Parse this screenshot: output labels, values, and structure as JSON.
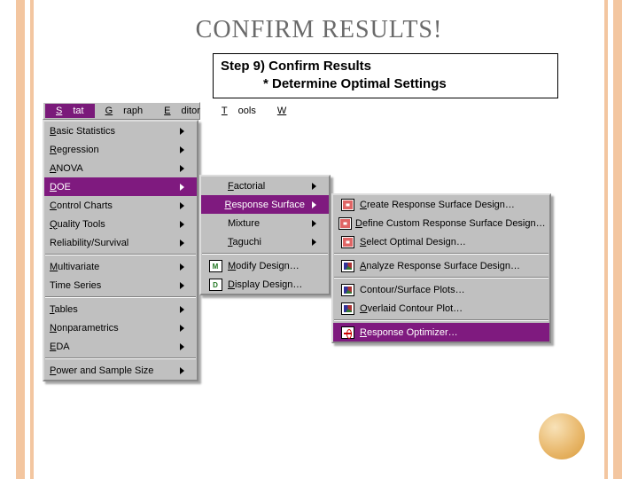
{
  "title": "CONFIRM RESULTS!",
  "step": {
    "line1": "Step 9) Confirm Results",
    "line2": "* Determine Optimal Settings"
  },
  "menubar": {
    "items": [
      {
        "label": "Stat",
        "mnemo": "S",
        "rest": "tat",
        "selected": true
      },
      {
        "label": "Graph",
        "mnemo": "G",
        "rest": "raph"
      },
      {
        "label": "Editor",
        "mnemo": "E",
        "rest": "ditor"
      },
      {
        "label": "Tools",
        "mnemo": "T",
        "rest": "ools"
      },
      {
        "label": "W",
        "mnemo": "W",
        "rest": ""
      }
    ]
  },
  "statMenu": {
    "items": [
      {
        "label": "Basic Statistics",
        "mnemo": "B",
        "rest": "asic Statistics",
        "sub": true
      },
      {
        "label": "Regression",
        "mnemo": "R",
        "rest": "egression",
        "sub": true
      },
      {
        "label": "ANOVA",
        "mnemo": "A",
        "rest": "NOVA",
        "sub": true
      },
      {
        "label": "DOE",
        "mnemo": "D",
        "rest": "OE",
        "sub": true,
        "hl": true
      },
      {
        "label": "Control Charts",
        "mnemo": "C",
        "rest": "ontrol Charts",
        "sub": true
      },
      {
        "label": "Quality Tools",
        "mnemo": "Q",
        "rest": "uality Tools",
        "sub": true
      },
      {
        "label": "Reliability/Survival",
        "mnemo": "",
        "rest": "Reliability/Survival",
        "sub": true
      },
      {
        "sep": true
      },
      {
        "label": "Multivariate",
        "mnemo": "M",
        "rest": "ultivariate",
        "sub": true
      },
      {
        "label": "Time Series",
        "mnemo": "",
        "rest": "Time Series",
        "sub": true
      },
      {
        "sep": true
      },
      {
        "label": "Tables",
        "mnemo": "T",
        "rest": "ables",
        "sub": true
      },
      {
        "label": "Nonparametrics",
        "mnemo": "N",
        "rest": "onparametrics",
        "sub": true
      },
      {
        "label": "EDA",
        "mnemo": "E",
        "rest": "DA",
        "sub": true
      },
      {
        "sep": true
      },
      {
        "label": "Power and Sample Size",
        "mnemo": "P",
        "rest": "ower and Sample Size",
        "sub": true
      }
    ]
  },
  "doeMenu": {
    "items": [
      {
        "label": "Factorial",
        "mnemo": "F",
        "rest": "actorial",
        "sub": true
      },
      {
        "label": "Response Surface",
        "mnemo": "R",
        "rest": "esponse Surface",
        "sub": true,
        "hl": true
      },
      {
        "label": "Mixture",
        "mnemo": "",
        "rest": "Mixture",
        "sub": true
      },
      {
        "label": "Taguchi",
        "mnemo": "T",
        "rest": "aguchi",
        "sub": true
      },
      {
        "sep": true
      },
      {
        "label": "Modify Design…",
        "mnemo": "M",
        "rest": "odify Design…",
        "icon": "MOD"
      },
      {
        "label": "Display Design…",
        "mnemo": "D",
        "rest": "isplay Design…",
        "icon": "DISP"
      }
    ]
  },
  "rsMenu": {
    "items": [
      {
        "label": "Create Response Surface Design…",
        "mnemo": "C",
        "rest": "reate Response Surface Design…",
        "icon": "grid"
      },
      {
        "label": "Define Custom Response Surface Design…",
        "mnemo": "D",
        "rest": "efine Custom Response Surface Design…",
        "icon": "grid"
      },
      {
        "label": "Select Optimal Design…",
        "mnemo": "S",
        "rest": "elect Optimal Design…",
        "icon": "grid"
      },
      {
        "sep": true
      },
      {
        "label": "Analyze Response Surface Design…",
        "mnemo": "A",
        "rest": "nalyze Response Surface Design…",
        "icon": "chart"
      },
      {
        "sep": true
      },
      {
        "label": "Contour/Surface Plots…",
        "mnemo": "",
        "rest": "Contour/Surface Plots…",
        "icon": "chart"
      },
      {
        "label": "Overlaid Contour Plot…",
        "mnemo": "O",
        "rest": "verlaid Contour Plot…",
        "icon": "chart"
      },
      {
        "sep": true
      },
      {
        "label": "Response Optimizer…",
        "mnemo": "R",
        "rest": "esponse Optimizer…",
        "icon": "opt",
        "hl": true
      }
    ]
  }
}
